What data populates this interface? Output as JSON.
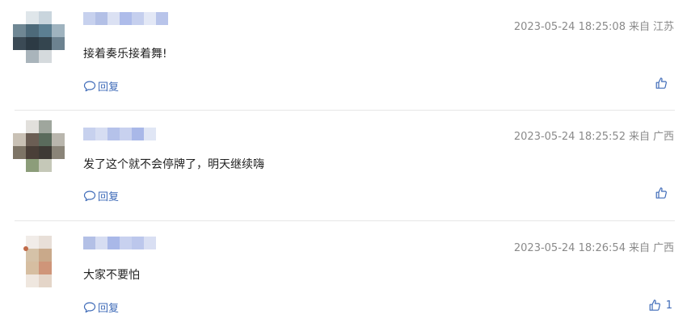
{
  "comments": [
    {
      "date": "2023-05-24 18:25:08",
      "from_label": "来自",
      "location": "江苏",
      "text": "接着奏乐接着舞!",
      "reply_label": "回复",
      "like_count": "",
      "avatar": "pixelated-avatar",
      "username": "pixelated-username"
    },
    {
      "date": "2023-05-24 18:25:52",
      "from_label": "来自",
      "location": "广西",
      "text": "发了这个就不会停牌了，明天继续嗨",
      "reply_label": "回复",
      "like_count": "",
      "avatar": "pixelated-avatar",
      "username": "pixelated-username"
    },
    {
      "date": "2023-05-24 18:26:54",
      "from_label": "来自",
      "location": "广西",
      "text": "大家不要怕",
      "reply_label": "回复",
      "like_count": "1",
      "avatar": "pixelated-avatar",
      "username": "pixelated-username"
    }
  ],
  "icons": {
    "reply": "speech-bubble-icon",
    "like": "thumbs-up-icon"
  },
  "colors": {
    "link": "#3f6bb8",
    "meta": "#8a8a8a",
    "divider": "#e6e6e6",
    "name_blur": "#b7c3e6"
  }
}
